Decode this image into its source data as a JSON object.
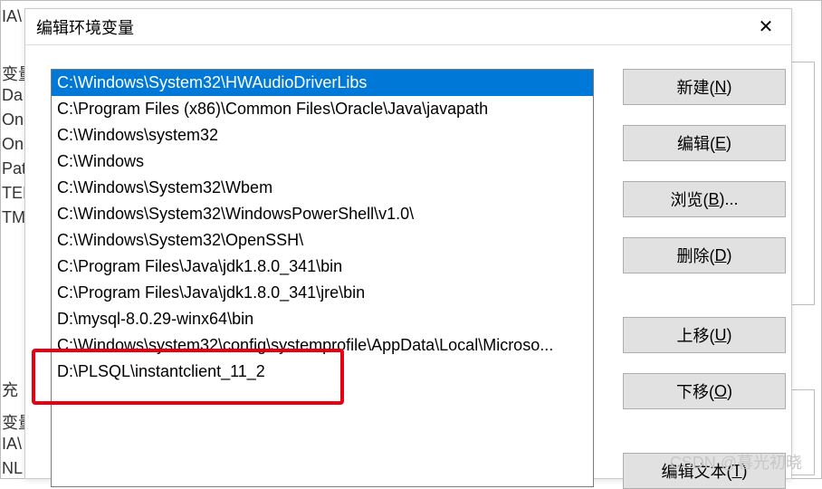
{
  "bgLabels": {
    "l1": "IA\\",
    "l2": "变量",
    "l3": "Da",
    "l4": "On",
    "l5": "On",
    "l6": "Pat",
    "l7": "TEI",
    "l8": "TM",
    "l9": "充",
    "l10": "变量",
    "l11": "IA\\",
    "l12": "NL"
  },
  "dialog": {
    "title": "编辑环境变量",
    "close": "✕"
  },
  "listItems": [
    "C:\\Windows\\System32\\HWAudioDriverLibs",
    "C:\\Program Files (x86)\\Common Files\\Oracle\\Java\\javapath",
    "C:\\Windows\\system32",
    "C:\\Windows",
    "C:\\Windows\\System32\\Wbem",
    "C:\\Windows\\System32\\WindowsPowerShell\\v1.0\\",
    "C:\\Windows\\System32\\OpenSSH\\",
    "C:\\Program Files\\Java\\jdk1.8.0_341\\bin",
    "C:\\Program Files\\Java\\jdk1.8.0_341\\jre\\bin",
    "D:\\mysql-8.0.29-winx64\\bin",
    "C:\\Windows\\system32\\config\\systemprofile\\AppData\\Local\\Microso...",
    "D:\\PLSQL\\instantclient_11_2"
  ],
  "buttons": {
    "new": {
      "text": "新建(",
      "u": "N",
      "tail": ")"
    },
    "edit": {
      "text": "编辑(",
      "u": "E",
      "tail": ")"
    },
    "browse": {
      "text": "浏览(",
      "u": "B",
      "tail": ")..."
    },
    "delete": {
      "text": "删除(",
      "u": "D",
      "tail": ")"
    },
    "up": {
      "text": "上移(",
      "u": "U",
      "tail": ")"
    },
    "down": {
      "text": "下移(",
      "u": "O",
      "tail": ")"
    },
    "editText": {
      "text": "编辑文本(",
      "u": "T",
      "tail": ")"
    }
  },
  "watermark": "CSDN @暮光初晓"
}
